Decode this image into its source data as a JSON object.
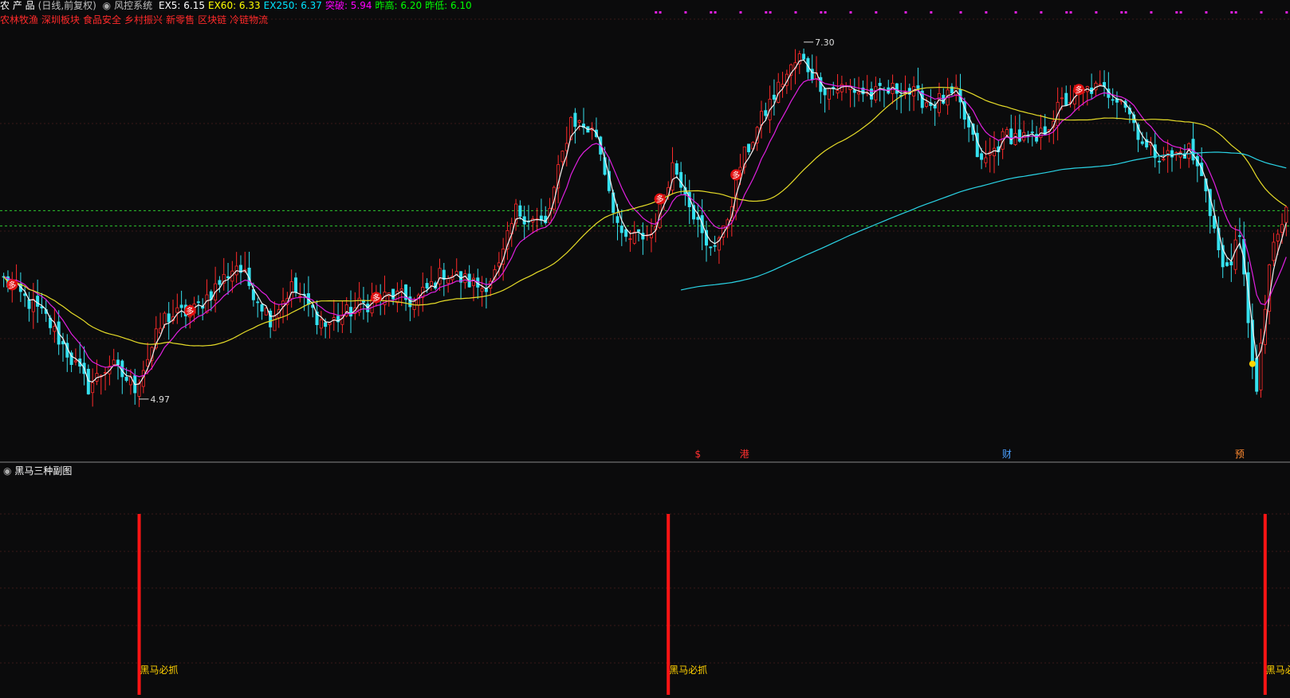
{
  "header": {
    "stock_name": "农 产 品",
    "period": "(日线,前复权)",
    "system_label": "风控系统",
    "indicators": [
      {
        "label": "EX5:",
        "value": "6.15",
        "color": "#ffffff"
      },
      {
        "label": "EX60:",
        "value": "6.33",
        "color": "#ffff00"
      },
      {
        "label": "EX250:",
        "value": "6.37",
        "color": "#00e5ff"
      },
      {
        "label": "突破:",
        "value": "5.94",
        "color": "#ff00ff"
      },
      {
        "label": "昨高:",
        "value": "6.20",
        "color": "#00ff00"
      },
      {
        "label": "昨低:",
        "value": "6.10",
        "color": "#00ff00"
      }
    ],
    "sectors": [
      "农林牧渔",
      "深圳板块",
      "食品安全",
      "乡村振兴",
      "新零售",
      "区块链",
      "冷链物流"
    ]
  },
  "colors": {
    "up": "#ff2a2a",
    "down": "#35e0ee",
    "ma_white": "#f2f2f2",
    "ma_magenta": "#e020e0",
    "ma_yellow": "#e6dc28",
    "ma_cyan": "#2ad4e6",
    "dashed_green": "#2ec82e",
    "grid": "#3a1818",
    "sub_bar": "#ff1414",
    "sub_label": "#ffd000",
    "dot": "#ffd400"
  },
  "chart_data": [
    {
      "type": "candlestick",
      "title": "",
      "ylim": [
        4.6,
        7.45
      ],
      "price_markers": [
        {
          "label": "7.30",
          "value": 7.3,
          "kind": "high"
        },
        {
          "label": "4.97",
          "value": 4.97,
          "kind": "low"
        }
      ],
      "dashed_levels": [
        6.2,
        6.1
      ],
      "buy_signal_glyph": "多",
      "buy_signal_indices": [
        2,
        44,
        88,
        155,
        173,
        254
      ],
      "event_markers": [
        {
          "label": "$",
          "index": 164,
          "color": "#ff3030"
        },
        {
          "label": "港",
          "index": 175,
          "color": "#ff3030"
        },
        {
          "label": "财",
          "index": 237,
          "color": "#4aa0ff"
        },
        {
          "label": "预",
          "index": 292,
          "color": "#ff8a30"
        }
      ],
      "yellow_dot_index": 295,
      "magenta_tick_count": 60,
      "keypoints": [
        {
          "i": 0,
          "price": 5.75
        },
        {
          "i": 10,
          "price": 5.5
        },
        {
          "i": 20,
          "price": 5.05
        },
        {
          "i": 25,
          "price": 5.2
        },
        {
          "i": 31,
          "price": 5.05
        },
        {
          "i": 38,
          "price": 5.5
        },
        {
          "i": 45,
          "price": 5.55
        },
        {
          "i": 55,
          "price": 5.85
        },
        {
          "i": 63,
          "price": 5.5
        },
        {
          "i": 68,
          "price": 5.7
        },
        {
          "i": 76,
          "price": 5.45
        },
        {
          "i": 84,
          "price": 5.58
        },
        {
          "i": 92,
          "price": 5.65
        },
        {
          "i": 97,
          "price": 5.6
        },
        {
          "i": 104,
          "price": 5.8
        },
        {
          "i": 113,
          "price": 5.7
        },
        {
          "i": 117,
          "price": 5.82
        },
        {
          "i": 121,
          "price": 6.2
        },
        {
          "i": 128,
          "price": 6.1
        },
        {
          "i": 134,
          "price": 6.8
        },
        {
          "i": 140,
          "price": 6.7
        },
        {
          "i": 146,
          "price": 6.0
        },
        {
          "i": 153,
          "price": 6.05
        },
        {
          "i": 158,
          "price": 6.5
        },
        {
          "i": 161,
          "price": 6.35
        },
        {
          "i": 166,
          "price": 5.95
        },
        {
          "i": 170,
          "price": 6.05
        },
        {
          "i": 174,
          "price": 6.5
        },
        {
          "i": 180,
          "price": 6.85
        },
        {
          "i": 184,
          "price": 7.05
        },
        {
          "i": 188,
          "price": 7.2
        },
        {
          "i": 194,
          "price": 7.0
        },
        {
          "i": 200,
          "price": 7.0
        },
        {
          "i": 205,
          "price": 6.95
        },
        {
          "i": 212,
          "price": 7.0
        },
        {
          "i": 219,
          "price": 6.9
        },
        {
          "i": 225,
          "price": 6.95
        },
        {
          "i": 231,
          "price": 6.5
        },
        {
          "i": 237,
          "price": 6.7
        },
        {
          "i": 244,
          "price": 6.65
        },
        {
          "i": 250,
          "price": 6.9
        },
        {
          "i": 257,
          "price": 7.0
        },
        {
          "i": 264,
          "price": 6.95
        },
        {
          "i": 270,
          "price": 6.6
        },
        {
          "i": 276,
          "price": 6.55
        },
        {
          "i": 280,
          "price": 6.6
        },
        {
          "i": 284,
          "price": 6.35
        },
        {
          "i": 288,
          "price": 5.8
        },
        {
          "i": 292,
          "price": 6.0
        },
        {
          "i": 296,
          "price": 5.0
        },
        {
          "i": 299,
          "price": 5.85
        },
        {
          "i": 303,
          "price": 6.2
        }
      ]
    },
    {
      "type": "bar",
      "title": "黑马三种副图",
      "categories": [
        "黑马必抓",
        "黑马必抓",
        "黑马必抓"
      ],
      "signal_indices": [
        32,
        157,
        298
      ],
      "values": [
        1,
        1,
        1
      ]
    }
  ]
}
